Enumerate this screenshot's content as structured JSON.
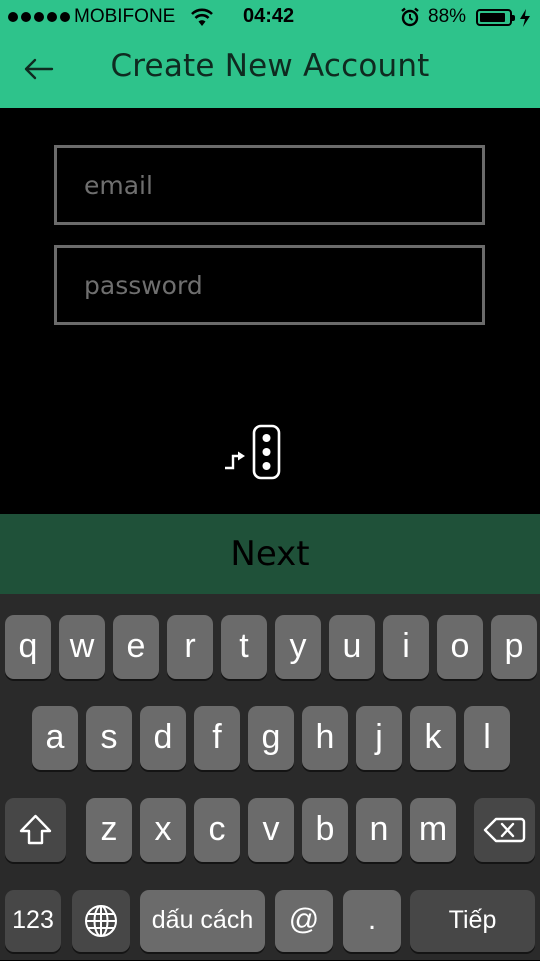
{
  "status_bar": {
    "carrier": "MOBIFONE",
    "time": "04:42",
    "battery_percent": "88%",
    "battery_level": 0.88
  },
  "header": {
    "title": "Create New Account",
    "back_icon": "arrow-left-icon",
    "background": "#2ec38b"
  },
  "form": {
    "email": {
      "placeholder": "email",
      "value": ""
    },
    "password": {
      "placeholder": "password",
      "value": ""
    }
  },
  "center_icon": "device-connect-icon",
  "next_button": {
    "label": "Next",
    "background": "#1f5139"
  },
  "keyboard": {
    "row1": [
      "q",
      "w",
      "e",
      "r",
      "t",
      "y",
      "u",
      "i",
      "o",
      "p"
    ],
    "row2": [
      "a",
      "s",
      "d",
      "f",
      "g",
      "h",
      "j",
      "k",
      "l"
    ],
    "row3": [
      "z",
      "x",
      "c",
      "v",
      "b",
      "n",
      "m"
    ],
    "numbers_label": "123",
    "space_label": "dấu cách",
    "at_label": "@",
    "period_label": ".",
    "return_label": "Tiếp",
    "globe_icon": "globe-icon",
    "shift_icon": "shift-icon",
    "delete_icon": "backspace-icon"
  }
}
